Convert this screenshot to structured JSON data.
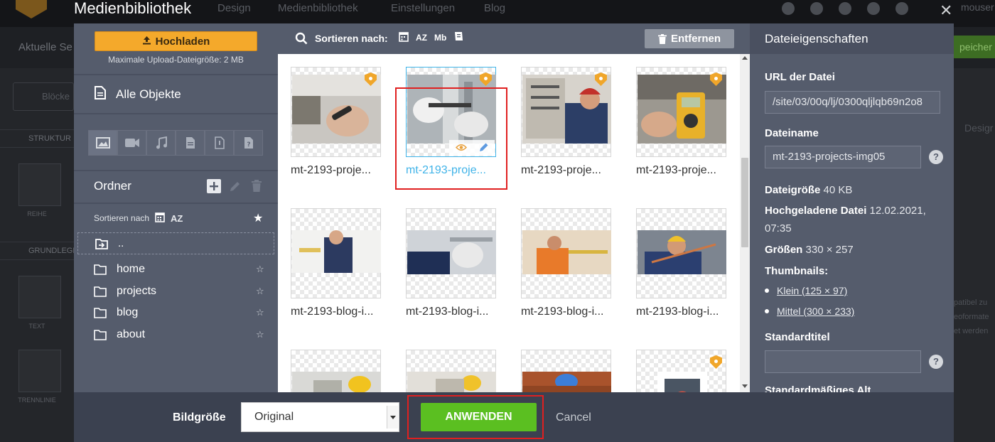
{
  "background": {
    "nav_items": [
      "Design",
      "Medienbibliothek",
      "Einstellungen",
      "Blog"
    ],
    "user_label": "mouser",
    "page_label": "Aktuelle Se",
    "save_label": "peicher",
    "blocks_label": "Blöcke",
    "sections": [
      {
        "label": "STRUKTUR"
      },
      {
        "label": "GRUNDLEGE"
      }
    ],
    "tools": [
      {
        "label": "REIHE"
      },
      {
        "label": "TEXT"
      },
      {
        "label": "TRENNLINIE"
      }
    ],
    "right_texts": [
      "Desigr",
      "patibel zu",
      "eoformate",
      "et werden"
    ]
  },
  "modal": {
    "title": "Medienbibliothek",
    "close_label": "✕",
    "upload_label": "Hochladen",
    "upload_note": "Maximale Upload-Dateigröße: 2 MB",
    "all_objects_label": "Alle Objekte",
    "folders_title": "Ordner",
    "sort_by_label": "Sortieren nach",
    "sort_az_label": "AZ",
    "up_folder_label": "..",
    "folders": [
      {
        "name": "home"
      },
      {
        "name": "projects"
      },
      {
        "name": "blog"
      },
      {
        "name": "about"
      }
    ],
    "grid_sort_label": "Sortieren nach:",
    "grid_sort_options": [
      "AZ",
      "Mb"
    ],
    "remove_label": "Entfernen",
    "tiles": [
      {
        "caption": "mt-2193-proje...",
        "badge": true,
        "selected": false
      },
      {
        "caption": "mt-2193-proje...",
        "badge": true,
        "selected": true
      },
      {
        "caption": "mt-2193-proje...",
        "badge": true,
        "selected": false
      },
      {
        "caption": "mt-2193-proje...",
        "badge": true,
        "selected": false
      },
      {
        "caption": "mt-2193-blog-i...",
        "badge": false,
        "selected": false
      },
      {
        "caption": "mt-2193-blog-i...",
        "badge": false,
        "selected": false
      },
      {
        "caption": "mt-2193-blog-i...",
        "badge": false,
        "selected": false
      },
      {
        "caption": "mt-2193-blog-i...",
        "badge": false,
        "selected": false
      },
      {
        "caption": "",
        "badge": false,
        "selected": false
      },
      {
        "caption": "",
        "badge": false,
        "selected": false
      },
      {
        "caption": "",
        "badge": false,
        "selected": false
      },
      {
        "caption": "",
        "badge": true,
        "selected": false
      }
    ],
    "properties": {
      "title": "Dateieigenschaften",
      "url_label": "URL der Datei",
      "url_value": "/site/03/00q/lj/0300qljlqb69n2o8",
      "filename_label": "Dateiname",
      "filename_value": "mt-2193-projects-img05",
      "filesize_label": "Dateigröße",
      "filesize_value": "40 KB",
      "uploaded_label": "Hochgeladene Datei",
      "uploaded_value_1": "12.02.2021,",
      "uploaded_value_2": "07:35",
      "sizes_label": "Größen",
      "sizes_value": "330 × 257",
      "thumbs_label": "Thumbnails:",
      "thumbs": [
        "Klein (125 × 97)",
        "Mittel (300 × 233)"
      ],
      "default_title_label": "Standardtitel",
      "default_title_value": "",
      "default_alt_label": "Standardmäßiges Alt",
      "help_glyph": "?"
    },
    "footer": {
      "image_size_label": "Bildgröße",
      "image_size_value": "Original",
      "apply_label": "ANWENDEN",
      "cancel_label": "Cancel"
    }
  },
  "colors": {
    "accent_orange": "#f4a92b",
    "apply_green": "#5bbf21",
    "selected_blue": "#3fb3e8",
    "highlight_red": "#e02020",
    "panel": "#555c6c"
  }
}
